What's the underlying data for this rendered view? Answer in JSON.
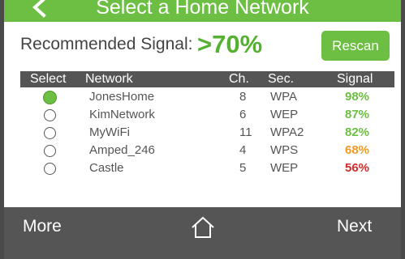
{
  "header": {
    "title": "Select a Home Network",
    "back_icon": "chevron-left-icon",
    "color": "#6cbf43"
  },
  "recommended": {
    "label": "Recommended Signal:",
    "value": ">70%",
    "value_color": "#56b132"
  },
  "rescan_button": {
    "label": "Rescan"
  },
  "table": {
    "headers": {
      "select": "Select",
      "network": "Network",
      "channel": "Ch.",
      "security": "Sec.",
      "signal": "Signal"
    },
    "rows": [
      {
        "network": "JonesHome",
        "channel": "8",
        "security": "WPA",
        "signal": "98%",
        "signal_color": "#6cbf43",
        "selected": true
      },
      {
        "network": "KimNetwork",
        "channel": "6",
        "security": "WEP",
        "signal": "87%",
        "signal_color": "#6cbf43",
        "selected": false
      },
      {
        "network": "MyWiFi",
        "channel": "11",
        "security": "WPA2",
        "signal": "82%",
        "signal_color": "#6cbf43",
        "selected": false
      },
      {
        "network": "Amped_246",
        "channel": "4",
        "security": "WPS",
        "signal": "68%",
        "signal_color": "#f39a24",
        "selected": false
      },
      {
        "network": "Castle",
        "channel": "5",
        "security": "WEP",
        "signal": "56%",
        "signal_color": "#d42b2b",
        "selected": false
      }
    ]
  },
  "footer": {
    "more_label": "More",
    "home_icon": "home-icon",
    "next_label": "Next"
  }
}
